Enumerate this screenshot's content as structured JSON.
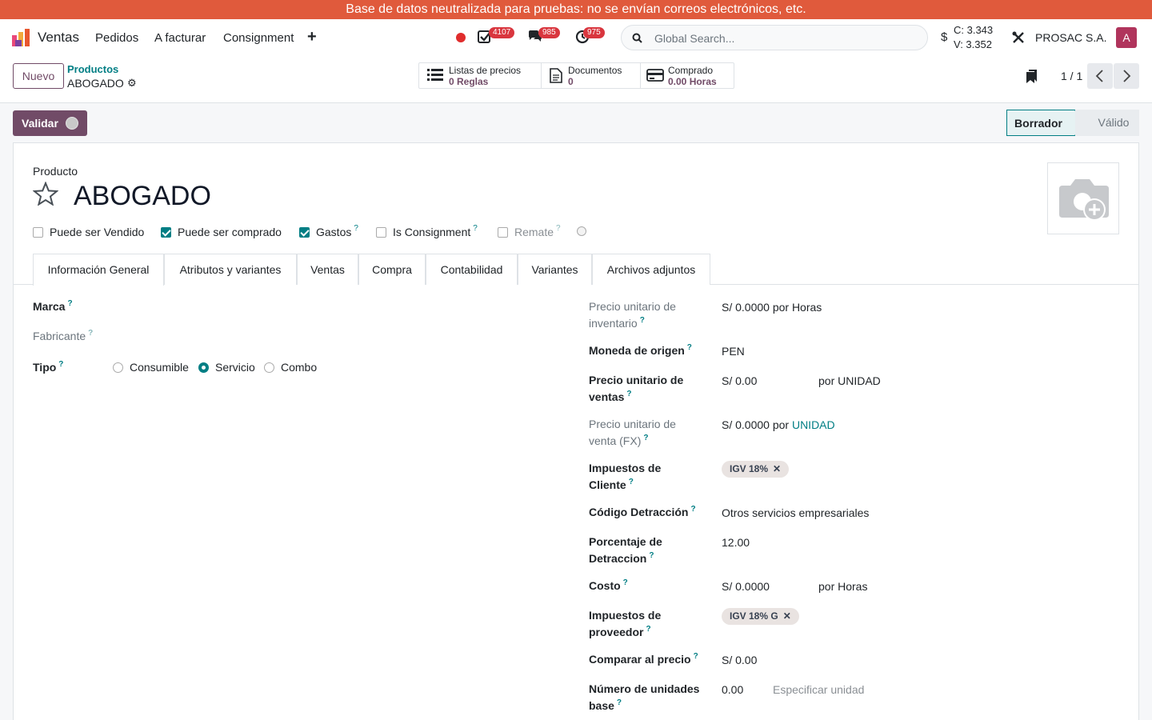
{
  "banner": {
    "text": "Base de datos neutralizada para pruebas: no se envían correos electrónicos, etc."
  },
  "navbar": {
    "app_name": "Ventas",
    "menu": [
      "Pedidos",
      "A facturar",
      "Consignment"
    ],
    "badges": {
      "activities": "4107",
      "messages": "985",
      "clock": "975"
    },
    "search_placeholder": "Global Search...",
    "currency_symbol": "$",
    "rate_c": "C: 3.343",
    "rate_v": "V: 3.352",
    "company": "PROSAC S.A.",
    "avatar_letter": "A"
  },
  "control": {
    "new_label": "Nuevo",
    "breadcrumb_parent": "Productos",
    "breadcrumb_current": "ABOGADO",
    "smart_buttons": [
      {
        "line1": "Listas de precios",
        "line2": "0  Reglas"
      },
      {
        "line1": "Documentos",
        "line2": "0"
      },
      {
        "line1": "Comprado",
        "line2": "0.00 Horas"
      }
    ],
    "pager": "1 / 1"
  },
  "actions": {
    "validate_label": "Validar",
    "stages": [
      "Borrador",
      "Válido"
    ]
  },
  "form": {
    "product_label": "Producto",
    "name": "ABOGADO",
    "checkboxes": [
      {
        "label": "Puede ser Vendido",
        "checked": false,
        "help": ""
      },
      {
        "label": "Puede ser comprado",
        "checked": true,
        "help": ""
      },
      {
        "label": "Gastos",
        "checked": true,
        "help": "?"
      },
      {
        "label": "Is Consignment",
        "checked": false,
        "help": "?"
      },
      {
        "label": "Remate",
        "checked": false,
        "help": "?"
      }
    ],
    "tabs": [
      "Información General",
      "Atributos y variantes",
      "Ventas",
      "Compra",
      "Contabilidad",
      "Variantes",
      "Archivos adjuntos"
    ],
    "left": {
      "marca_label": "Marca",
      "fabricante_label": "Fabricante",
      "tipo_label": "Tipo",
      "tipo_options": [
        "Consumible",
        "Servicio",
        "Combo"
      ],
      "tipo_selected": "Servicio"
    },
    "right": {
      "precio_inv_label": "Precio unitario de inventario",
      "precio_inv_value": "S/ 0.0000 por Horas",
      "moneda_label": "Moneda de origen",
      "moneda_value": "PEN",
      "precio_venta_label": "Precio unitario de ventas",
      "precio_venta_value": "S/ 0.00",
      "precio_venta_uom": "por UNIDAD",
      "precio_fx_label": "Precio unitario de venta (FX)",
      "precio_fx_value": "S/ 0.0000 por",
      "precio_fx_uom": "UNIDAD",
      "imp_cliente_label": "Impuestos de Cliente",
      "imp_cliente_tag": "IGV 18%",
      "detraccion_label": "Código Detracción",
      "detraccion_value": "Otros servicios empresariales",
      "porc_label": "Porcentaje de Detraccion",
      "porc_value": "12.00",
      "costo_label": "Costo",
      "costo_value": "S/ 0.0000",
      "costo_uom": "por Horas",
      "imp_prov_label": "Impuestos de proveedor",
      "imp_prov_tag": "IGV 18% G",
      "comparar_label": "Comparar al precio",
      "comparar_value": "S/ 0.00",
      "unidades_label": "Número de unidades base",
      "unidades_value": "0.00",
      "unidades_placeholder": "Especificar unidad"
    }
  },
  "colors": {
    "banner": "#e05a3c",
    "brand": "#714b67",
    "accent": "#017e84",
    "badge": "#d9363e"
  }
}
